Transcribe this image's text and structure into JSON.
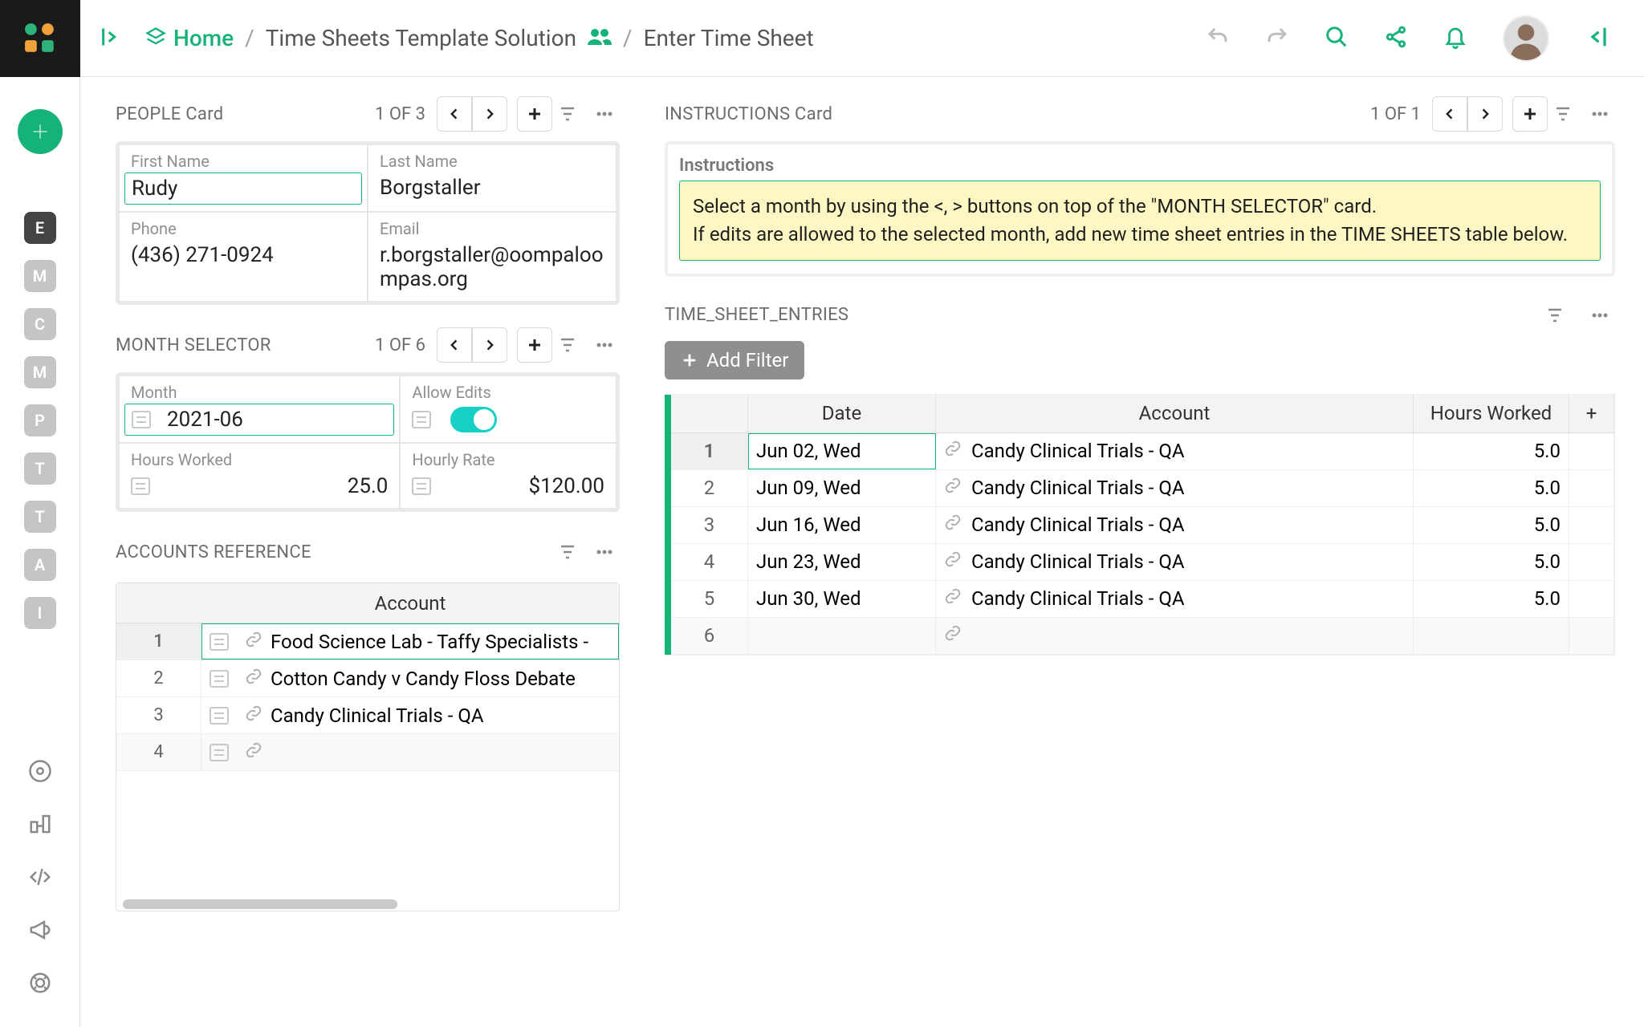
{
  "breadcrumb": {
    "home": "Home",
    "solution": "Time Sheets Template Solution",
    "page": "Enter Time Sheet"
  },
  "rail": {
    "items": [
      "E",
      "M",
      "C",
      "M",
      "P",
      "T",
      "T",
      "A",
      "I"
    ],
    "selected_index": 0
  },
  "people_card": {
    "title": "PEOPLE Card",
    "counter": "1 OF 3",
    "fields": {
      "first_name_label": "First Name",
      "first_name": "Rudy",
      "last_name_label": "Last Name",
      "last_name": "Borgstaller",
      "phone_label": "Phone",
      "phone": "(436) 271-0924",
      "email_label": "Email",
      "email": "r.borgstaller@oompaloompas.org"
    }
  },
  "month_selector": {
    "title": "MONTH SELECTOR",
    "counter": "1 OF 6",
    "month_label": "Month",
    "month": "2021-06",
    "allow_edits_label": "Allow Edits",
    "allow_edits": true,
    "hours_worked_label": "Hours Worked",
    "hours_worked": "25.0",
    "hourly_rate_label": "Hourly Rate",
    "hourly_rate": "$120.00"
  },
  "accounts_reference": {
    "title": "ACCOUNTS REFERENCE",
    "header": "Account",
    "rows": [
      "Food Science Lab - Taffy Specialists -",
      "Cotton Candy v Candy Floss Debate",
      "Candy Clinical Trials - QA"
    ]
  },
  "instructions_card": {
    "title": "INSTRUCTIONS Card",
    "counter": "1 OF 1",
    "label": "Instructions",
    "text": "Select a month by using the <, > buttons on top of the \"MONTH SELECTOR\" card.\nIf edits are allowed to the selected month, add new time sheet entries in the TIME SHEETS table below."
  },
  "time_sheet_entries": {
    "title": "TIME_SHEET_ENTRIES",
    "add_filter": "Add Filter",
    "columns": {
      "date": "Date",
      "account": "Account",
      "hours": "Hours Worked"
    },
    "rows": [
      {
        "date": "Jun 02, Wed",
        "account": "Candy Clinical Trials - QA",
        "hours": "5.0"
      },
      {
        "date": "Jun 09, Wed",
        "account": "Candy Clinical Trials - QA",
        "hours": "5.0"
      },
      {
        "date": "Jun 16, Wed",
        "account": "Candy Clinical Trials - QA",
        "hours": "5.0"
      },
      {
        "date": "Jun 23, Wed",
        "account": "Candy Clinical Trials - QA",
        "hours": "5.0"
      },
      {
        "date": "Jun 30, Wed",
        "account": "Candy Clinical Trials - QA",
        "hours": "5.0"
      }
    ]
  }
}
